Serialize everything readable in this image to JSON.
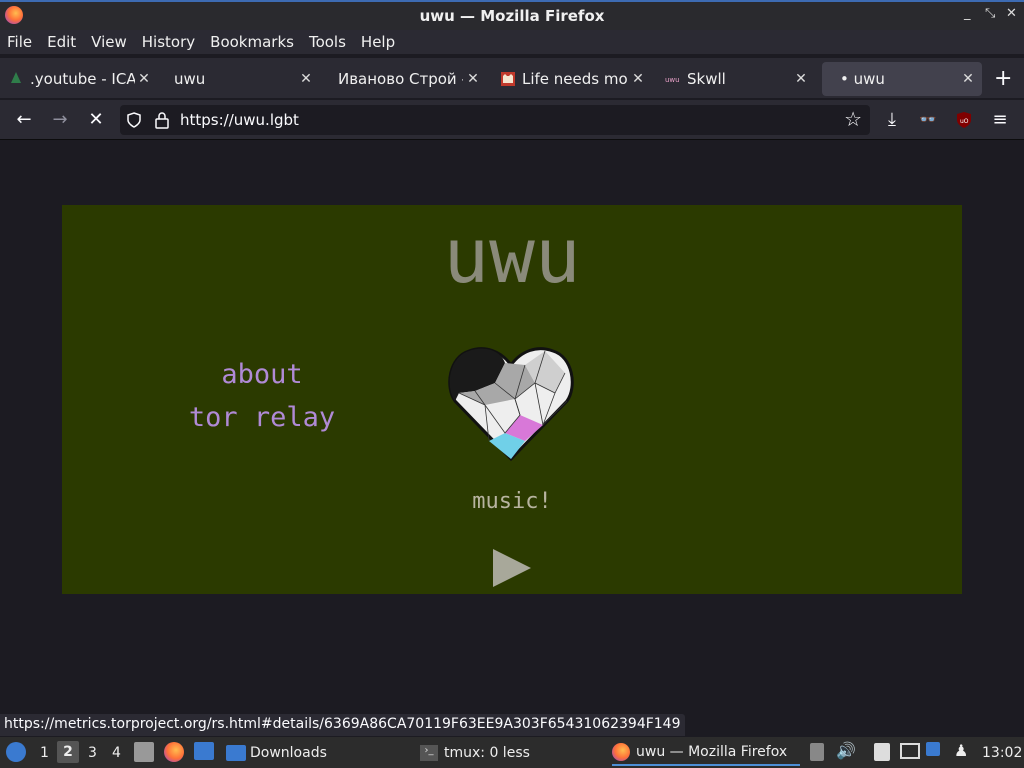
{
  "window": {
    "title": "uwu — Mozilla Firefox"
  },
  "menu": [
    "File",
    "Edit",
    "View",
    "History",
    "Bookmarks",
    "Tools",
    "Help"
  ],
  "tabs": [
    {
      "label": ".youtube - ICA",
      "icon": "leaf-icon"
    },
    {
      "label": "uwu",
      "icon": ""
    },
    {
      "label": "Иваново Строй -",
      "icon": ""
    },
    {
      "label": "Life needs mo",
      "icon": "cat-icon"
    },
    {
      "label": "Skwll",
      "icon": "uwu-icon"
    },
    {
      "label": "• uwu",
      "icon": ""
    }
  ],
  "nav": {
    "url": "https://uwu.lgbt"
  },
  "site": {
    "title": "uwu",
    "links": [
      "about",
      "tor relay"
    ],
    "music_label": "music!"
  },
  "status_url": "https://metrics.torproject.org/rs.html#details/6369A86CA70119F63EE9A303F65431062394F149",
  "taskbar": {
    "workspaces": [
      "1",
      "2",
      "3",
      "4"
    ],
    "tasks": [
      "Downloads",
      "tmux: 0 less",
      "uwu — Mozilla Firefox"
    ],
    "clock": "13:02"
  }
}
